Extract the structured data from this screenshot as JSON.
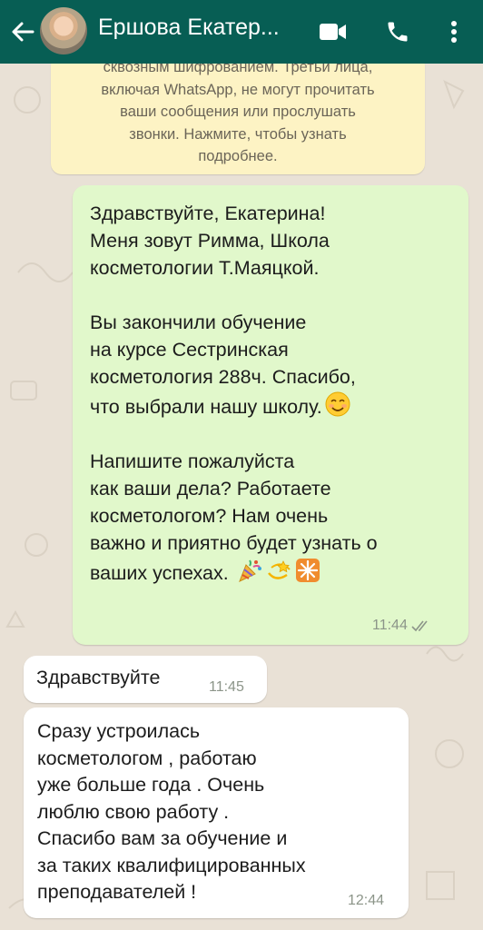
{
  "header": {
    "contact_name": "Ершова Екатер...",
    "back_icon": "arrow-left-icon",
    "video_icon": "video-camera-icon",
    "call_icon": "phone-icon",
    "menu_icon": "more-vert-icon"
  },
  "encryption_notice": {
    "lines": [
      "сквозным шифрованием. Третьи лица,",
      "включая WhatsApp, не могут прочитать",
      "ваши сообщения или прослушать",
      "звонки. Нажмите, чтобы узнать",
      "подробнее."
    ]
  },
  "messages": [
    {
      "direction": "outgoing",
      "paragraphs": [
        [
          "Здравствуйте, Екатерина!",
          "Меня зовут Римма, Школа",
          "косметологии Т.Маяцкой."
        ],
        [
          "Вы закончили обучение",
          "на курсе Сестринская",
          "косметология 288ч. Спасибо,",
          "что выбрали нашу школу."
        ],
        [
          "Напишите пожалуйста",
          "как ваши дела? Работаете",
          "косметологом? Нам очень",
          "важно и приятно будет узнать о",
          "ваших успехах."
        ]
      ],
      "emojis": [
        "smiling-face-icon",
        "party-popper-icon",
        "dizzy-star-icon",
        "sparkle-icon"
      ],
      "time": "11:44",
      "status_icon": "double-check-icon"
    },
    {
      "direction": "incoming",
      "lines": [
        "Здравствуйте"
      ],
      "time": "11:45"
    },
    {
      "direction": "incoming",
      "lines": [
        "Сразу устроилась",
        "косметологом , работаю",
        "уже больше года . Очень",
        "люблю свою работу .",
        "Спасибо вам за обучение и",
        "за таких квалифицированных",
        "преподавателей !"
      ],
      "time": "12:44"
    }
  ],
  "colors": {
    "header_bg": "#075e54",
    "chat_bg": "#e9e1d6",
    "outgoing_bubble": "#e1f8cb",
    "incoming_bubble": "#ffffff",
    "notice_bg": "#fdf3c4",
    "timestamp": "#8c9589"
  }
}
